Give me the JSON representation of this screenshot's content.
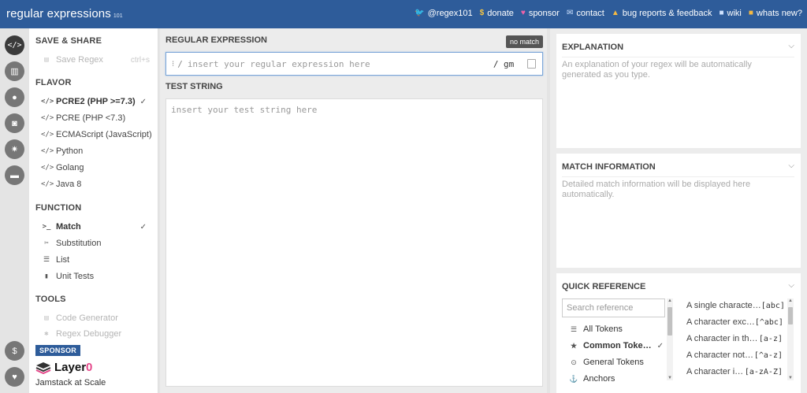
{
  "header": {
    "brand": "regular expressions",
    "brand_sup": "101",
    "nav": [
      {
        "label": "@regex101",
        "icon": "twitter-icon",
        "glyph": "🐦"
      },
      {
        "label": "donate",
        "icon": "dollar-icon",
        "glyph": "$"
      },
      {
        "label": "sponsor",
        "icon": "heart-icon",
        "glyph": "♥"
      },
      {
        "label": "contact",
        "icon": "envelope-icon",
        "glyph": "✉"
      },
      {
        "label": "bug reports & feedback",
        "icon": "warning-icon",
        "glyph": "▲"
      },
      {
        "label": "wiki",
        "icon": "book-icon",
        "glyph": "■"
      },
      {
        "label": "whats new?",
        "icon": "news-icon",
        "glyph": "■"
      }
    ]
  },
  "rail": {
    "buttons": [
      {
        "name": "regex-editor-icon",
        "glyph": "</>"
      },
      {
        "name": "library-icon",
        "glyph": "▥"
      },
      {
        "name": "account-icon",
        "glyph": "●"
      },
      {
        "name": "quiz-icon",
        "glyph": "◙"
      },
      {
        "name": "settings-icon",
        "glyph": "✷"
      },
      {
        "name": "chat-icon",
        "glyph": "▬"
      },
      {
        "name": "donate-icon",
        "glyph": "$"
      },
      {
        "name": "sponsor-icon",
        "glyph": "♥"
      }
    ]
  },
  "left": {
    "save_share": {
      "title": "SAVE & SHARE",
      "save_regex": "Save Regex",
      "shortcut": "ctrl+s"
    },
    "flavor": {
      "title": "FLAVOR",
      "items": [
        {
          "label": "PCRE2 (PHP >=7.3)",
          "selected": true
        },
        {
          "label": "PCRE (PHP <7.3)",
          "selected": false
        },
        {
          "label": "ECMAScript (JavaScript)",
          "selected": false
        },
        {
          "label": "Python",
          "selected": false
        },
        {
          "label": "Golang",
          "selected": false
        },
        {
          "label": "Java 8",
          "selected": false
        }
      ]
    },
    "function": {
      "title": "FUNCTION",
      "items": [
        {
          "label": "Match",
          "selected": true,
          "icon": "terminal-icon",
          "glyph": ">_"
        },
        {
          "label": "Substitution",
          "selected": false,
          "icon": "scissors-icon",
          "glyph": "✂"
        },
        {
          "label": "List",
          "selected": false,
          "icon": "list-icon",
          "glyph": "☰"
        },
        {
          "label": "Unit Tests",
          "selected": false,
          "icon": "flask-icon",
          "glyph": "▮"
        }
      ]
    },
    "tools": {
      "title": "TOOLS",
      "items": [
        {
          "label": "Code Generator",
          "icon": "code-generator-icon",
          "glyph": "▤"
        },
        {
          "label": "Regex Debugger",
          "icon": "bug-icon",
          "glyph": "✱"
        }
      ]
    },
    "sponsor": {
      "tag": "SPONSOR",
      "name_main": "Layer",
      "name_zero": "0",
      "tagline": "Jamstack at Scale"
    }
  },
  "middle": {
    "regex_title": "REGULAR EXPRESSION",
    "status_badge": "no match",
    "drag_handle": "⁝",
    "open_delim": "/",
    "regex_placeholder": "insert your regular expression here",
    "flags": "/ gm",
    "test_title": "TEST STRING",
    "test_placeholder": "insert your test string here"
  },
  "right": {
    "explanation": {
      "title": "EXPLANATION",
      "text": "An explanation of your regex will be automatically generated as you type."
    },
    "match_info": {
      "title": "MATCH INFORMATION",
      "text": "Detailed match information will be displayed here automatically."
    },
    "quick_ref": {
      "title": "QUICK REFERENCE",
      "search_placeholder": "Search reference",
      "categories": [
        {
          "label": "All Tokens",
          "icon": "all-tokens-icon",
          "glyph": "☰",
          "selected": false
        },
        {
          "label": "Common Toke…",
          "icon": "star-icon",
          "glyph": "★",
          "selected": true
        },
        {
          "label": "General Tokens",
          "icon": "general-tokens-icon",
          "glyph": "⊙",
          "selected": false
        },
        {
          "label": "Anchors",
          "icon": "anchor-icon",
          "glyph": "⚓",
          "selected": false
        }
      ],
      "tokens": [
        {
          "desc": "A single characte…",
          "code": "[abc]"
        },
        {
          "desc": "A character exc…",
          "code": "[^abc]"
        },
        {
          "desc": "A character in th…",
          "code": "[a-z]"
        },
        {
          "desc": "A character not…",
          "code": "[^a-z]"
        },
        {
          "desc": "A character i…",
          "code": "[a-zA-Z]"
        }
      ]
    }
  }
}
